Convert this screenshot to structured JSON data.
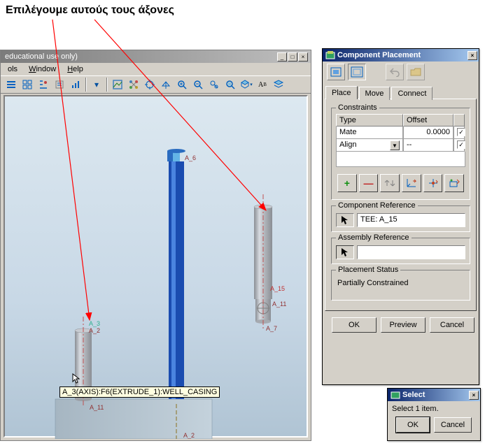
{
  "annotation_text": "Επιλέγουμε αυτούς τους άξονες",
  "titlebar": "educational use only)",
  "menus": {
    "tools": "ols",
    "window": "Window",
    "help": "Help"
  },
  "viewport": {
    "tooltip": "A_3(AXIS):F6(EXTRUDE_1):WELL_CASING",
    "labels": {
      "a2_upper": "A_2",
      "a3": "A_3",
      "a11_left": "A_11",
      "a2_lower": "A_2",
      "a6": "A_6",
      "a15": "A_15",
      "a11_right": "A_11",
      "a7": "A_7"
    }
  },
  "placement": {
    "title": "Component Placement",
    "tabs": {
      "place": "Place",
      "move": "Move",
      "connect": "Connect"
    },
    "constraints_group": "Constraints",
    "headers": {
      "type": "Type",
      "offset": "Offset"
    },
    "row1": {
      "type": "Mate",
      "offset": "0.0000"
    },
    "row2": {
      "type": "Align",
      "offset": "--"
    },
    "comp_ref_group": "Component Reference",
    "comp_ref_value": "TEE: A_15",
    "asm_ref_group": "Assembly Reference",
    "asm_ref_value": "",
    "status_group": "Placement Status",
    "status_value": "Partially Constrained",
    "buttons": {
      "ok": "OK",
      "preview": "Preview",
      "cancel": "Cancel"
    }
  },
  "select": {
    "title": "Select",
    "msg": "Select 1 item.",
    "ok": "OK",
    "cancel": "Cancel"
  }
}
